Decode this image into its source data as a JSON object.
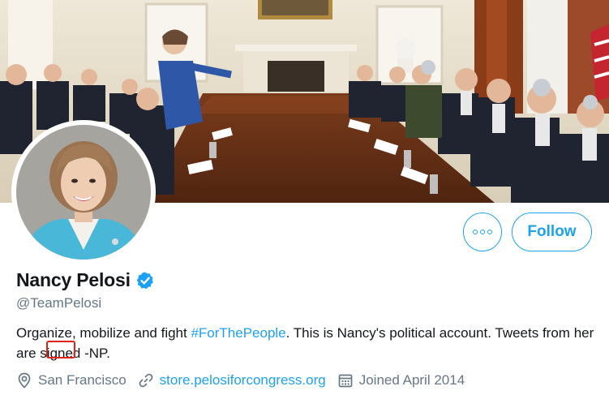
{
  "profile": {
    "display_name": "Nancy Pelosi",
    "handle": "@TeamPelosi",
    "verified": true,
    "bio": {
      "part1": "Organize, mobilize and fight ",
      "hashtag": "#ForThePeople",
      "part2": ". This is Nancy's political account. Tweets from ",
      "highlighted_word": "her",
      "part3": " are signed -NP."
    },
    "location": "San Francisco",
    "website": "store.pelosiforcongress.org",
    "joined": "Joined April 2014"
  },
  "actions": {
    "follow_label": "Follow",
    "more_label": "More"
  },
  "icons": {
    "more": "more-options-icon",
    "verified": "verified-badge-icon",
    "location": "location-pin-icon",
    "link": "link-icon",
    "calendar": "calendar-icon"
  },
  "colors": {
    "accent": "#1da1f2",
    "text": "#14171a",
    "secondary_text": "#657786",
    "highlight_box": "#e0241a"
  }
}
